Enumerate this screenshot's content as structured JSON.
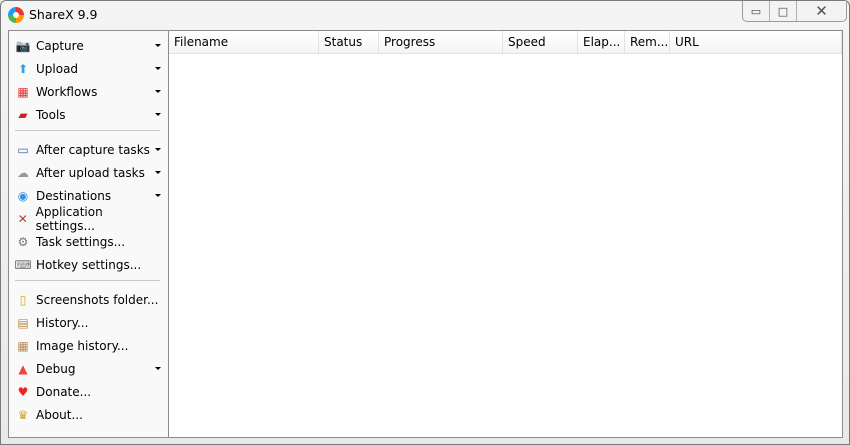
{
  "window": {
    "title": "ShareX 9.9",
    "minimize": "▭",
    "maximize": "□",
    "close": "✕"
  },
  "sidebar": {
    "items": [
      {
        "label": "Capture",
        "icon": "camera-icon",
        "glyph": "📷",
        "color": "#777",
        "dropdown": true
      },
      {
        "label": "Upload",
        "icon": "upload-arrow-icon",
        "glyph": "⬆",
        "color": "#3a9ee4",
        "dropdown": true
      },
      {
        "label": "Workflows",
        "icon": "workflows-grid-icon",
        "glyph": "▦",
        "color": "#d33",
        "dropdown": true
      },
      {
        "label": "Tools",
        "icon": "toolbox-icon",
        "glyph": "▰",
        "color": "#c22",
        "dropdown": true
      },
      {
        "label": "After capture tasks",
        "icon": "image-icon",
        "glyph": "▭",
        "color": "#3a6ea5",
        "dropdown": true
      },
      {
        "label": "After upload tasks",
        "icon": "cloud-icon",
        "glyph": "☁",
        "color": "#999",
        "dropdown": true
      },
      {
        "label": "Destinations",
        "icon": "globe-icon",
        "glyph": "◉",
        "color": "#3a8ee0",
        "dropdown": true
      },
      {
        "label": "Application settings...",
        "icon": "wrench-icon",
        "glyph": "✕",
        "color": "#a44",
        "dropdown": false
      },
      {
        "label": "Task settings...",
        "icon": "gear-icon",
        "glyph": "⚙",
        "color": "#777",
        "dropdown": false
      },
      {
        "label": "Hotkey settings...",
        "icon": "keyboard-icon",
        "glyph": "⌨",
        "color": "#777",
        "dropdown": false
      },
      {
        "label": "Screenshots folder...",
        "icon": "folder-icon",
        "glyph": "▯",
        "color": "#d9a520",
        "dropdown": false
      },
      {
        "label": "History...",
        "icon": "history-icon",
        "glyph": "▤",
        "color": "#b85",
        "dropdown": false
      },
      {
        "label": "Image history...",
        "icon": "image-history-icon",
        "glyph": "▦",
        "color": "#b85",
        "dropdown": false
      },
      {
        "label": "Debug",
        "icon": "traffic-cone-icon",
        "glyph": "▲",
        "color": "#e44",
        "dropdown": true
      },
      {
        "label": "Donate...",
        "icon": "heart-icon",
        "glyph": "♥",
        "color": "#e22",
        "dropdown": false
      },
      {
        "label": "About...",
        "icon": "crown-icon",
        "glyph": "♛",
        "color": "#d9a520",
        "dropdown": false
      }
    ]
  },
  "columns": [
    "Filename",
    "Status",
    "Progress",
    "Speed",
    "Elap...",
    "Rem...",
    "URL"
  ]
}
